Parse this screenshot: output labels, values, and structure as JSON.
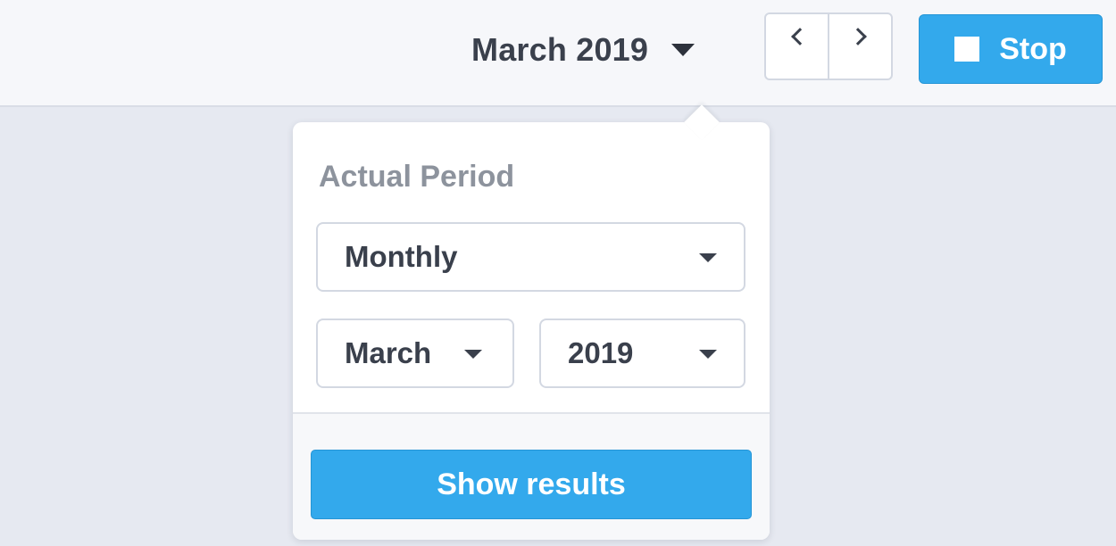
{
  "header": {
    "period_label": "March 2019",
    "period_toggle_icon": "caret-down-icon",
    "prev_icon": "chevron-left-icon",
    "next_icon": "chevron-right-icon",
    "stop_label": "Stop",
    "stop_icon": "stop-square-icon"
  },
  "popover": {
    "heading": "Actual Period",
    "period_type": {
      "value": "Monthly",
      "icon": "caret-down-icon"
    },
    "month": {
      "value": "March",
      "icon": "caret-down-icon"
    },
    "year": {
      "value": "2019",
      "icon": "caret-down-icon"
    },
    "submit_label": "Show results"
  },
  "colors": {
    "accent": "#33a9ec",
    "topbar_background": "#f6f7fa",
    "page_background": "#e6e9f1",
    "text": "#3a404c",
    "muted_text": "#8d939d"
  }
}
